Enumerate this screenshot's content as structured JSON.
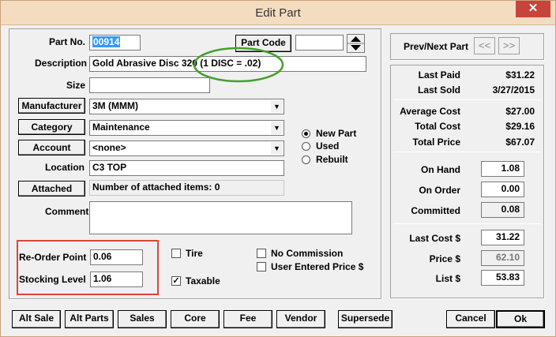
{
  "window": {
    "title": "Edit Part",
    "close_glyph": "✕"
  },
  "labels": {
    "part_no": "Part No.",
    "description": "Description",
    "size": "Size",
    "location": "Location",
    "comment": "Comment",
    "reorder_point": "Re-Order Point",
    "stocking_level": "Stocking Level"
  },
  "buttons": {
    "part_code": "Part Code",
    "manufacturer": "Manufacturer",
    "category": "Category",
    "account": "Account",
    "attached": "Attached",
    "prev_next": "Prev/Next Part",
    "prev": "<<",
    "next": ">>"
  },
  "fields": {
    "part_no": "00914",
    "part_code": "",
    "description": "Gold Abrasive Disc 320 (1 DISC = .02)",
    "size": "",
    "manufacturer": "3M (MMM)",
    "category": "Maintenance",
    "account": "<none>",
    "location": "C3 TOP",
    "attached": "Number of attached items: 0",
    "comment": "",
    "reorder_point": "0.06",
    "stocking_level": "1.06"
  },
  "condition": {
    "options": [
      "New Part",
      "Used",
      "Rebuilt"
    ],
    "selected": "New Part"
  },
  "checkboxes": {
    "tire": {
      "label": "Tire",
      "checked": false
    },
    "taxable": {
      "label": "Taxable",
      "checked": true,
      "mark": "✓"
    },
    "no_commission": {
      "label": "No Commission",
      "checked": false
    },
    "user_entered_price": {
      "label": "User Entered Price $",
      "checked": false
    }
  },
  "stats": {
    "last_paid": {
      "label": "Last Paid",
      "value": "$31.22"
    },
    "last_sold": {
      "label": "Last Sold",
      "value": "3/27/2015"
    },
    "average_cost": {
      "label": "Average Cost",
      "value": "$27.00"
    },
    "total_cost": {
      "label": "Total Cost",
      "value": "$29.16"
    },
    "total_price": {
      "label": "Total Price",
      "value": "$67.07"
    }
  },
  "inventory": {
    "on_hand": {
      "label": "On Hand",
      "value": "1.08"
    },
    "on_order": {
      "label": "On Order",
      "value": "0.00"
    },
    "committed": {
      "label": "Committed",
      "value": "0.08"
    }
  },
  "pricing": {
    "last_cost": {
      "label": "Last Cost $",
      "value": "31.22"
    },
    "price": {
      "label": "Price $",
      "value": "62.10"
    },
    "list": {
      "label": "List $",
      "value": "53.83"
    }
  },
  "bottom_buttons": {
    "alt_sale": "Alt Sale",
    "alt_parts": "Alt Parts",
    "sales": "Sales",
    "core": "Core",
    "fee": "Fee",
    "vendor": "Vendor",
    "supersede": "Supersede",
    "cancel": "Cancel",
    "ok": "Ok"
  },
  "colors": {
    "highlight_ring": "#44a02c",
    "reorder_box": "#d9463a",
    "selection": "#3399ff"
  }
}
